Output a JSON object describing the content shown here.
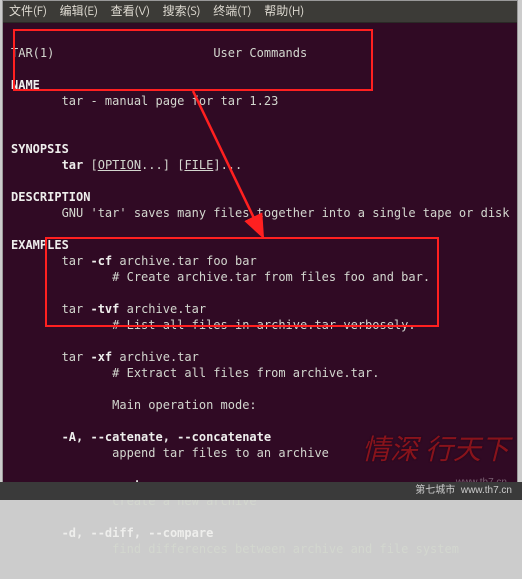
{
  "menubar": {
    "file": "文件(F)",
    "edit": "编辑(E)",
    "view": "查看(V)",
    "search": "搜索(S)",
    "terminal": "终端(T)",
    "help": "帮助(H)"
  },
  "man": {
    "header_left": "TAR(1)",
    "header_center": "User Commands",
    "name_heading": "NAME",
    "name_line": "tar - manual page for tar 1.23",
    "synopsis_heading": "SYNOPSIS",
    "synopsis_cmd": "tar",
    "synopsis_opt": "OPTION",
    "synopsis_file": "FILE",
    "description_heading": "DESCRIPTION",
    "description_line": "GNU 'tar' saves many files together into a single tape or disk",
    "examples_heading": "EXAMPLES",
    "ex1_cmd": "tar -cf archive.tar foo bar",
    "ex1_note": "# Create archive.tar from files foo and bar.",
    "ex2_cmd": "tar -tvf archive.tar",
    "ex2_note": "# List all files in archive.tar verbosely.",
    "ex3_cmd": "tar -xf archive.tar",
    "ex3_note": "# Extract all files from archive.tar.",
    "mode_heading": "Main operation mode:",
    "optA_flags": "-A, --catenate, --concatenate",
    "optA_desc": "append tar files to an archive",
    "optC_flags": "-c, --create",
    "optC_desc": "create a new archive",
    "optD_flags": "-d, --diff, --compare",
    "optD_desc": "find differences between archive and file system"
  },
  "watermark": {
    "stylized": "情深 行天下",
    "site": "www.th7.cn"
  },
  "footer": {
    "brand": "第七城市",
    "url": "www.th7.cn"
  }
}
